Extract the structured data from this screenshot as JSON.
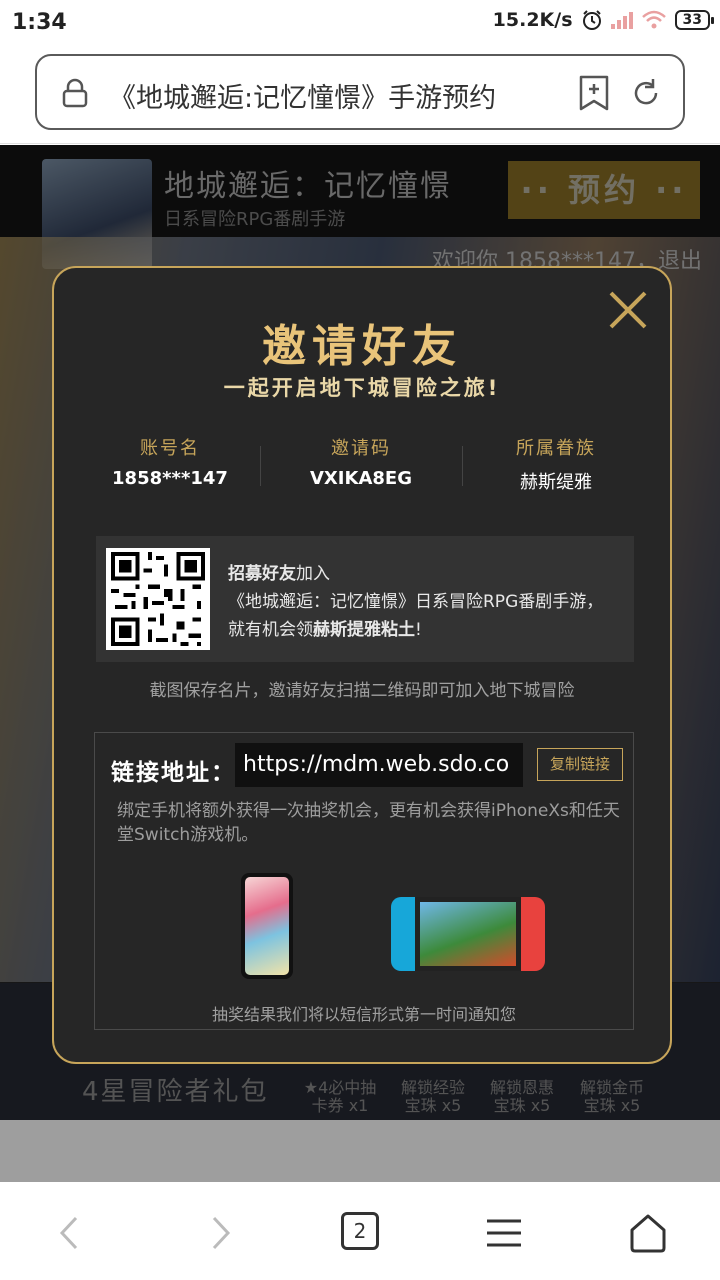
{
  "status_bar": {
    "time": "1:34",
    "net_speed": "15.2K/s",
    "battery": "33"
  },
  "browser": {
    "url_text": "《地城邂逅:记忆憧憬》手游预约",
    "tab_count": "2"
  },
  "page_header": {
    "game_title": "地城邂逅：记忆憧憬",
    "game_subtitle": "日系冒险RPG番剧手游",
    "reserve_label": "·· 预约 ··",
    "welcome": "欢迎你 1858***147，退出"
  },
  "gift": {
    "title": "4星冒险者礼包",
    "items": [
      {
        "line1": "★4必中抽",
        "line2": "卡券 x1"
      },
      {
        "line1": "解锁经验",
        "line2": "宝珠 x5"
      },
      {
        "line1": "解锁恩惠",
        "line2": "宝珠 x5"
      },
      {
        "line1": "解锁金币",
        "line2": "宝珠 x5"
      }
    ]
  },
  "modal": {
    "title": "邀请好友",
    "subtitle": "一起开启地下城冒险之旅!",
    "info": [
      {
        "label": "账号名",
        "value": "1858***147"
      },
      {
        "label": "邀请码",
        "value": "VXIKA8EG"
      },
      {
        "label": "所属眷族",
        "value": "赫斯缇雅"
      }
    ],
    "qr_text": {
      "bold1": "招募好友",
      "t1": "加入",
      "t2": "《地城邂逅：记忆憧憬》日系冒险RPG番剧手游，",
      "t3": "就有机会领",
      "bold2": "赫斯提雅粘土",
      "t4": "!"
    },
    "hint": "截图保存名片，邀请好友扫描二维码即可加入地下城冒险",
    "link_label": "链接地址：",
    "link_value": "https://mdm.web.sdo.co",
    "copy_label": "复制链接",
    "bind_text": "绑定手机将额外获得一次抽奖机会，更有机会获得iPhoneXs和任天堂Switch游戏机。",
    "result_text": "抽奖结果我们将以短信形式第一时间通知您"
  },
  "colors": {
    "accent_gold": "#c7a55a",
    "title_gold": "#e9c47a",
    "modal_bg": "#262626"
  }
}
